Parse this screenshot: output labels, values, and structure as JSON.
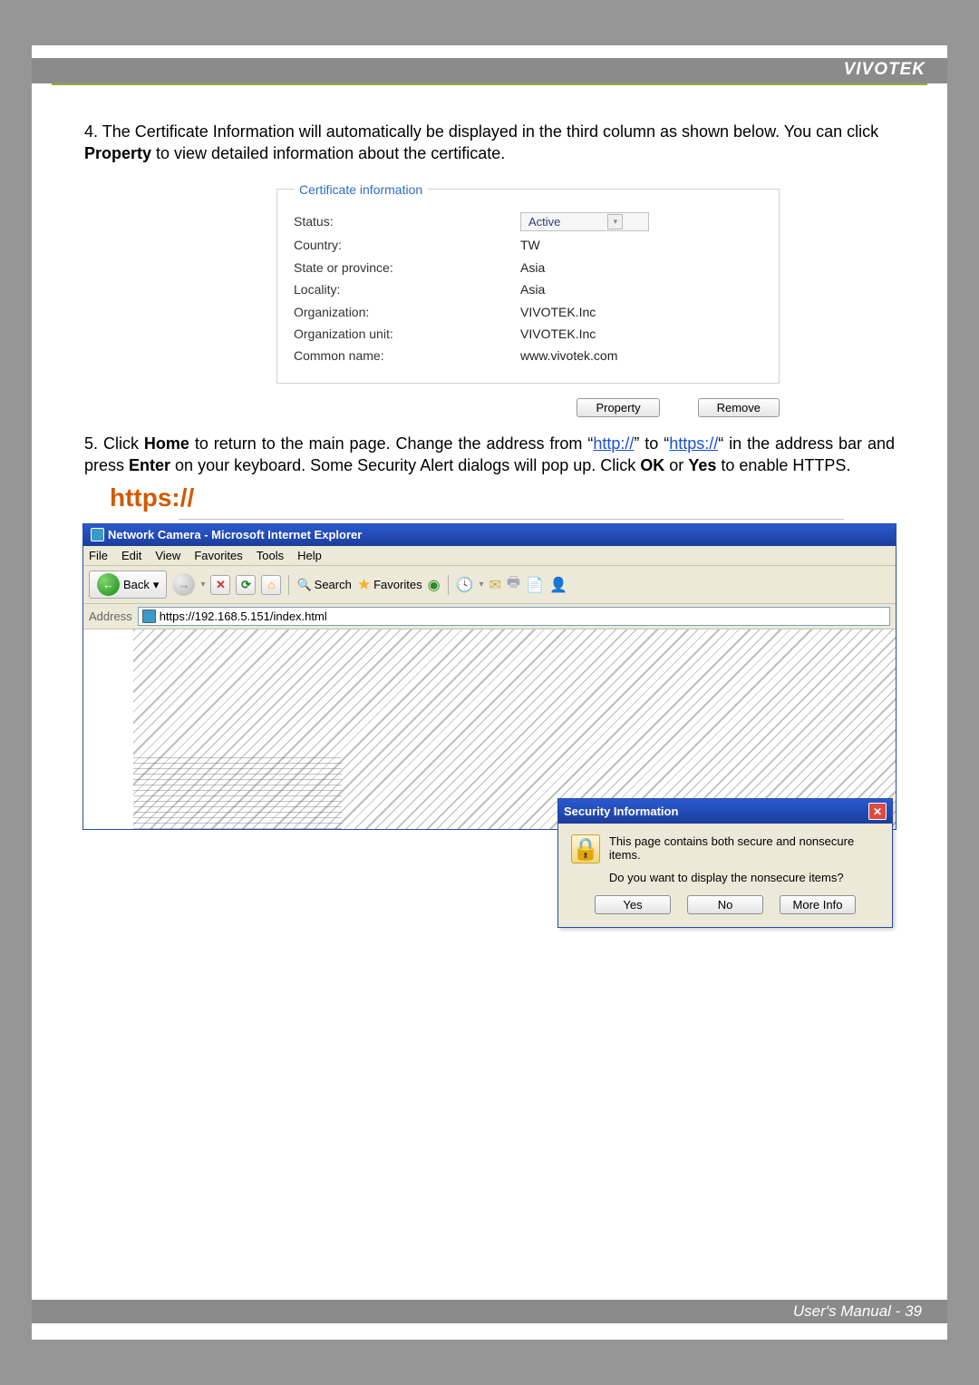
{
  "brand": "VIVOTEK",
  "step4": {
    "num": "4.",
    "text_a": "The Certificate Information will automatically be displayed in the third column as shown below. You can click ",
    "prop": "Property",
    "text_b": " to view detailed information about the certificate."
  },
  "cert": {
    "legend": "Certificate information",
    "status_label": "Status:",
    "status_value": "Active",
    "country_label": "Country:",
    "country_value": "TW",
    "state_label": "State or province:",
    "state_value": "Asia",
    "locality_label": "Locality:",
    "locality_value": "Asia",
    "org_label": "Organization:",
    "org_value": "VIVOTEK.Inc",
    "orgunit_label": "Organization unit:",
    "orgunit_value": "VIVOTEK.Inc",
    "cn_label": "Common name:",
    "cn_value": "www.vivotek.com"
  },
  "buttons": {
    "property": "Property",
    "remove": "Remove"
  },
  "step5": {
    "num": "5.",
    "a": "Click ",
    "home": "Home",
    "b": " to return to the main page. Change the address from “",
    "http": "http://",
    "c": "” to “",
    "https": "https://",
    "d": "“ in the address bar and press ",
    "enter": "Enter",
    "e": " on your keyboard. Some Security Alert dialogs will pop up. Click ",
    "ok": "OK",
    "f": " or ",
    "yes": "Yes",
    "g": " to enable HTTPS."
  },
  "https_marker": "https://",
  "ie": {
    "title": "Network Camera - Microsoft Internet Explorer",
    "menu": {
      "file": "File",
      "edit": "Edit",
      "view": "View",
      "favorites": "Favorites",
      "tools": "Tools",
      "help": "Help"
    },
    "toolbar": {
      "back": "Back",
      "search": "Search",
      "favorites": "Favorites"
    },
    "address_label": "Address",
    "address_value": "https://192.168.5.151/index.html"
  },
  "dialog": {
    "title": "Security Information",
    "line1": "This page contains both secure and nonsecure items.",
    "line2": "Do you want to display the nonsecure items?",
    "yes": "Yes",
    "no": "No",
    "more": "More Info"
  },
  "footer": {
    "label": "User's Manual - ",
    "page": "39"
  }
}
